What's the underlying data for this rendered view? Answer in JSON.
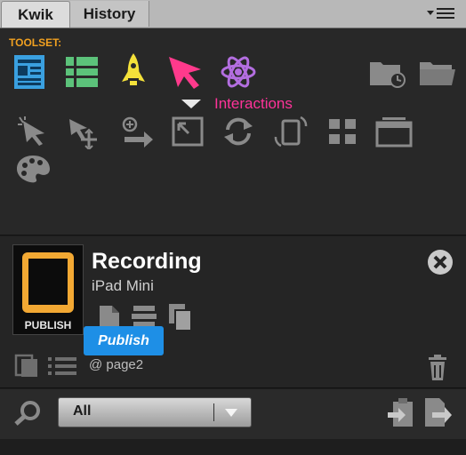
{
  "tabs": [
    {
      "label": "Kwik"
    },
    {
      "label": "History"
    }
  ],
  "toolset": {
    "label": "TOOLSET:",
    "tools": [
      "document-icon",
      "list-icon",
      "rocket-icon",
      "pointer-icon",
      "atom-icon"
    ],
    "right_icons": [
      "folder-clock-icon",
      "folder-icon"
    ]
  },
  "interactions": {
    "label": "Interactions",
    "icons": [
      "click-pointer-icon",
      "drag-icon",
      "swipe-icon",
      "expand-icon",
      "refresh-icon",
      "rotate-device-icon",
      "grid-icon",
      "window-icon",
      "palette-icon"
    ]
  },
  "recording": {
    "title": "Recording",
    "device": "iPad Mini",
    "thumb_label": "PUBLISH",
    "publish_button": "Publish",
    "page": "@ page2"
  },
  "filter": {
    "selected": "All"
  },
  "colors": {
    "accent": "#f0a020",
    "pink": "#ff3399",
    "publish": "#1e8fe6",
    "tablet": "#f2a833"
  }
}
